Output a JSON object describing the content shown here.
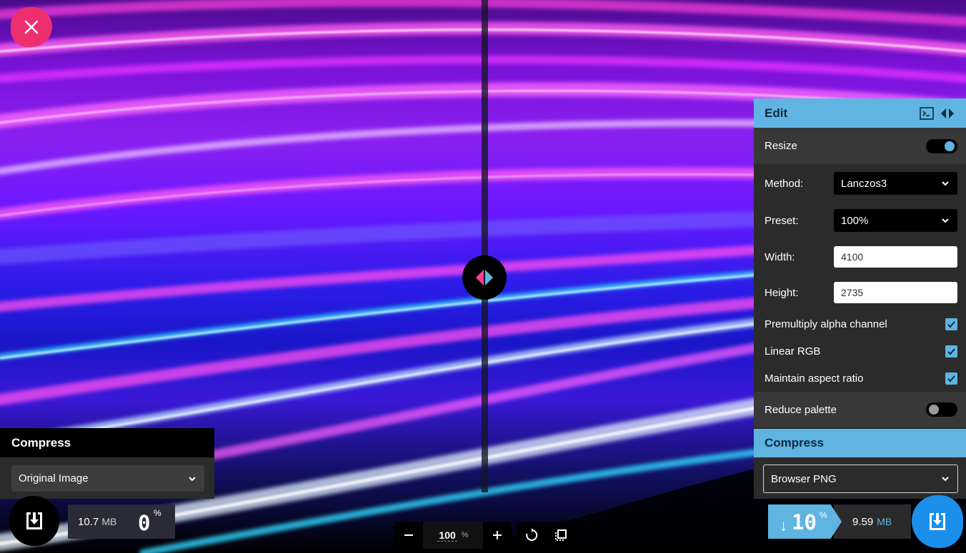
{
  "viewer": {
    "zoom_value": "100",
    "zoom_unit": "%"
  },
  "left": {
    "panel_title": "Compress",
    "select_value": "Original Image",
    "size_value": "10.7",
    "size_unit": "MB",
    "percent_value": "0",
    "percent_unit": "%"
  },
  "edit": {
    "title": "Edit",
    "resize_label": "Resize",
    "resize_on": true,
    "method_label": "Method:",
    "method_value": "Lanczos3",
    "preset_label": "Preset:",
    "preset_value": "100%",
    "width_label": "Width:",
    "width_value": "4100",
    "height_label": "Height:",
    "height_value": "2735",
    "premultiply_label": "Premultiply alpha channel",
    "premultiply_checked": true,
    "linear_rgb_label": "Linear RGB",
    "linear_rgb_checked": true,
    "aspect_label": "Maintain aspect ratio",
    "aspect_checked": true,
    "reduce_palette_label": "Reduce palette",
    "reduce_palette_on": false
  },
  "right": {
    "compress_title": "Compress",
    "select_value": "Browser PNG",
    "arrow": "↓",
    "percent_value": "10",
    "percent_unit": "%",
    "size_value": "9.59",
    "size_unit": "MB"
  },
  "colors": {
    "accent": "#5fb4e1",
    "close": "#ee2f6e",
    "download_right": "#1c8fea",
    "handle_left": "#ff3d8f",
    "handle_right": "#5fb4e6"
  },
  "icons": [
    "close-icon",
    "download-icon",
    "minus-icon",
    "plus-icon",
    "rotate-icon",
    "crop-icon",
    "terminal-icon",
    "split-arrows-icon",
    "chevron-down-icon",
    "check-icon"
  ]
}
